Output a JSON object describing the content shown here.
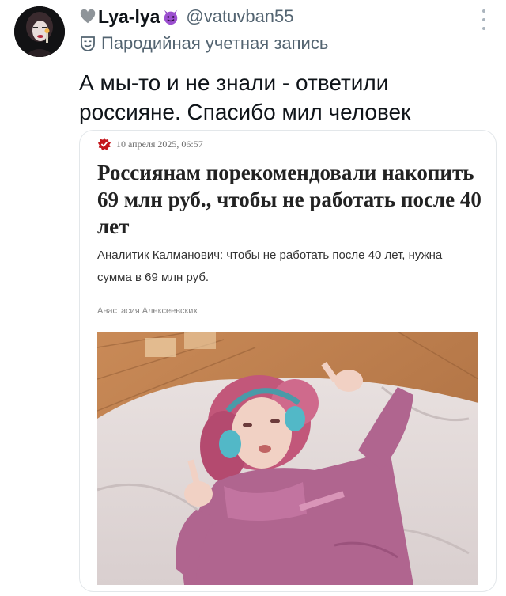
{
  "user": {
    "display_name": "Lya-lya",
    "handle": "@vatuvban55",
    "badge_text": "Пародийная учетная запись",
    "name_emoji_left": "grey-heart-icon",
    "name_emoji_right": "smiling-imp-icon"
  },
  "tweet": {
    "text_line1": "А мы-то и не знали - ответили",
    "text_line2": "россияне. Спасибо мил человек"
  },
  "card": {
    "date": "10 апреля 2025, 06:57",
    "headline": "Россиянам порекомендовали накопить 69 млн руб., чтобы не работать после 40 лет",
    "subtitle": "Аналитик Калманович: чтобы не работать после 40 лет, нужна сумма в 69 млн руб.",
    "author": "Анастасия Алексеевских",
    "logo_icon": "publisher-logo-icon",
    "accent_color": "#c4161c"
  }
}
